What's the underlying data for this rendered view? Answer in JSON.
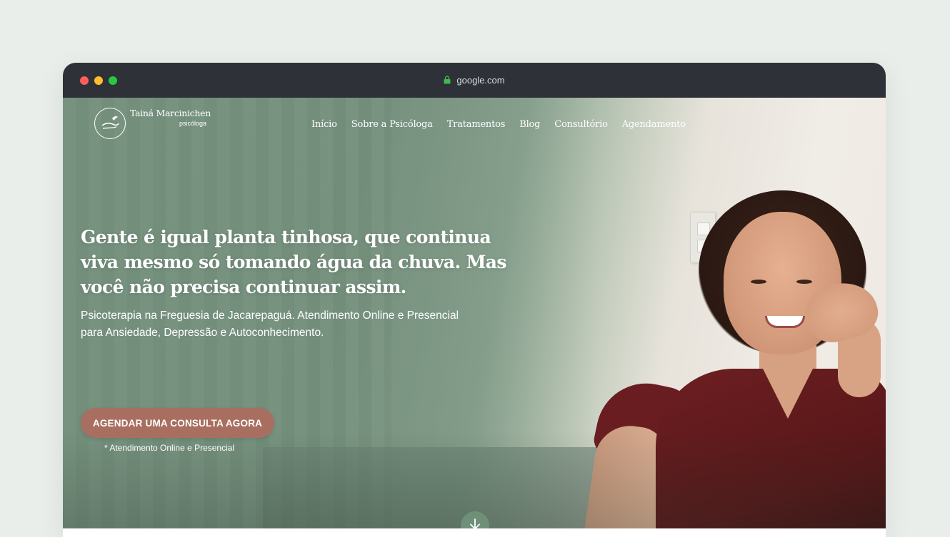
{
  "browser": {
    "url": "google.com"
  },
  "brand": {
    "name": "Tainá Marcinichen",
    "tagline": "psicóloga"
  },
  "nav": {
    "items": [
      "Início",
      "Sobre a Psicóloga",
      "Tratamentos",
      "Blog",
      "Consultório",
      "Agendamento"
    ]
  },
  "hero": {
    "headline": "Gente é igual planta tinhosa, que continua viva mesmo só tomando água da chuva. Mas você não precisa continuar assim.",
    "subheadline": "Psicoterapia na Freguesia de Jacarepaguá. Atendimento Online e Presencial para Ansiedade, Depressão e Autoconhecimento.",
    "cta_label": "AGENDAR UMA CONSULTA AGORA",
    "cta_note": "* Atendimento Online e Presencial"
  },
  "colors": {
    "page_bg": "#e9eeea",
    "chrome": "#2e3137",
    "hero_green": "#7d9785",
    "cta": "#a86f60"
  },
  "icons": [
    "lock-icon",
    "logo-hands-icon",
    "arrow-down-icon"
  ]
}
